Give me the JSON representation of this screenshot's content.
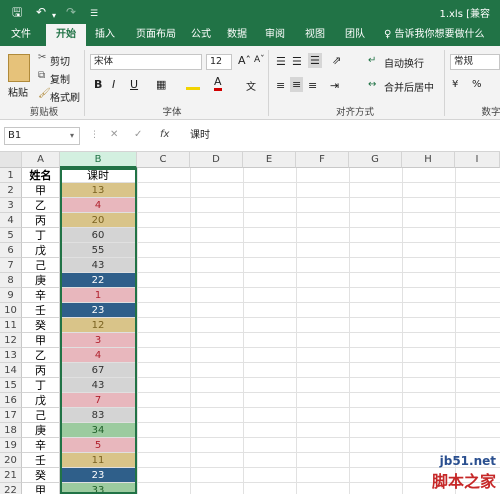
{
  "titlebar": {
    "save_icon": "save-icon",
    "undo_icon": "undo-icon",
    "redo_icon": "redo-icon",
    "customize_icon": "customize-icon",
    "filename": "1.xls [兼容"
  },
  "tabs": [
    {
      "label": "文件"
    },
    {
      "label": "开始"
    },
    {
      "label": "插入"
    },
    {
      "label": "页面布局"
    },
    {
      "label": "公式"
    },
    {
      "label": "数据"
    },
    {
      "label": "审阅"
    },
    {
      "label": "视图"
    },
    {
      "label": "团队"
    }
  ],
  "tell_me": "♀ 告诉我你想要做什么",
  "ribbon": {
    "paste": "粘贴",
    "cut": "剪切",
    "copy": "复制",
    "format_painter": "格式刷",
    "clipboard_group": "剪贴板",
    "font_name": "宋体",
    "font_size": "12",
    "bold": "B",
    "italic": "I",
    "underline": "U",
    "font_group": "字体",
    "wrap_text": "自动换行",
    "merge_center": "合并后居中",
    "alignment_group": "对齐方式",
    "number_format": "常规",
    "number_group": "数字"
  },
  "formula_bar": {
    "name_box": "B1",
    "cancel": "✕",
    "enter": "✓",
    "fx": "fx",
    "content": "课时"
  },
  "columns": [
    "A",
    "B",
    "C",
    "D",
    "E",
    "F",
    "G",
    "H",
    "I"
  ],
  "header_row": {
    "a": "姓名",
    "b": "课时"
  },
  "rows": [
    {
      "num": "1",
      "name": "姓名",
      "hours": "课时"
    },
    {
      "num": "2",
      "name": "甲",
      "hours": "13"
    },
    {
      "num": "3",
      "name": "乙",
      "hours": "4"
    },
    {
      "num": "4",
      "name": "丙",
      "hours": "20"
    },
    {
      "num": "5",
      "name": "丁",
      "hours": "60"
    },
    {
      "num": "6",
      "name": "戊",
      "hours": "55"
    },
    {
      "num": "7",
      "name": "己",
      "hours": "43"
    },
    {
      "num": "8",
      "name": "庚",
      "hours": "22"
    },
    {
      "num": "9",
      "name": "辛",
      "hours": "1"
    },
    {
      "num": "10",
      "name": "壬",
      "hours": "23"
    },
    {
      "num": "11",
      "name": "癸",
      "hours": "12"
    },
    {
      "num": "12",
      "name": "甲",
      "hours": "3"
    },
    {
      "num": "13",
      "name": "乙",
      "hours": "4"
    },
    {
      "num": "14",
      "name": "丙",
      "hours": "67"
    },
    {
      "num": "15",
      "name": "丁",
      "hours": "43"
    },
    {
      "num": "16",
      "name": "戊",
      "hours": "7"
    },
    {
      "num": "17",
      "name": "己",
      "hours": "83"
    },
    {
      "num": "18",
      "name": "庚",
      "hours": "34"
    },
    {
      "num": "19",
      "name": "辛",
      "hours": "5"
    },
    {
      "num": "20",
      "name": "壬",
      "hours": "11"
    },
    {
      "num": "21",
      "name": "癸",
      "hours": "23"
    },
    {
      "num": "22",
      "name": "甲",
      "hours": "33"
    }
  ],
  "cell_styles": {
    "13": {
      "bg": "#d9c489",
      "fg": "#7a6220"
    },
    "4": {
      "bg": "#e8b7bd",
      "fg": "#b0202d"
    },
    "20": {
      "bg": "#d9c489",
      "fg": "#7a6220"
    },
    "60": {
      "bg": "#d4d4d4",
      "fg": "#333333"
    },
    "55": {
      "bg": "#d4d4d4",
      "fg": "#333333"
    },
    "43": {
      "bg": "#d4d4d4",
      "fg": "#333333"
    },
    "22": {
      "bg": "#2f5f8a",
      "fg": "#ffffff"
    },
    "1": {
      "bg": "#e8b7bd",
      "fg": "#b0202d"
    },
    "23": {
      "bg": "#2f5f8a",
      "fg": "#ffffff"
    },
    "12": {
      "bg": "#d9c489",
      "fg": "#7a6220"
    },
    "3": {
      "bg": "#e8b7bd",
      "fg": "#b0202d"
    },
    "67": {
      "bg": "#d4d4d4",
      "fg": "#333333"
    },
    "7": {
      "bg": "#e8b7bd",
      "fg": "#b0202d"
    },
    "83": {
      "bg": "#d4d4d4",
      "fg": "#333333"
    },
    "34": {
      "bg": "#9ccb9f",
      "fg": "#1e5e28"
    },
    "5": {
      "bg": "#e8b7bd",
      "fg": "#b0202d"
    },
    "11": {
      "bg": "#d9c489",
      "fg": "#7a6220"
    },
    "33": {
      "bg": "#9ccb9f",
      "fg": "#1e5e28"
    }
  },
  "watermark": {
    "line1": "jb51.net",
    "line2": "脚本之家"
  }
}
